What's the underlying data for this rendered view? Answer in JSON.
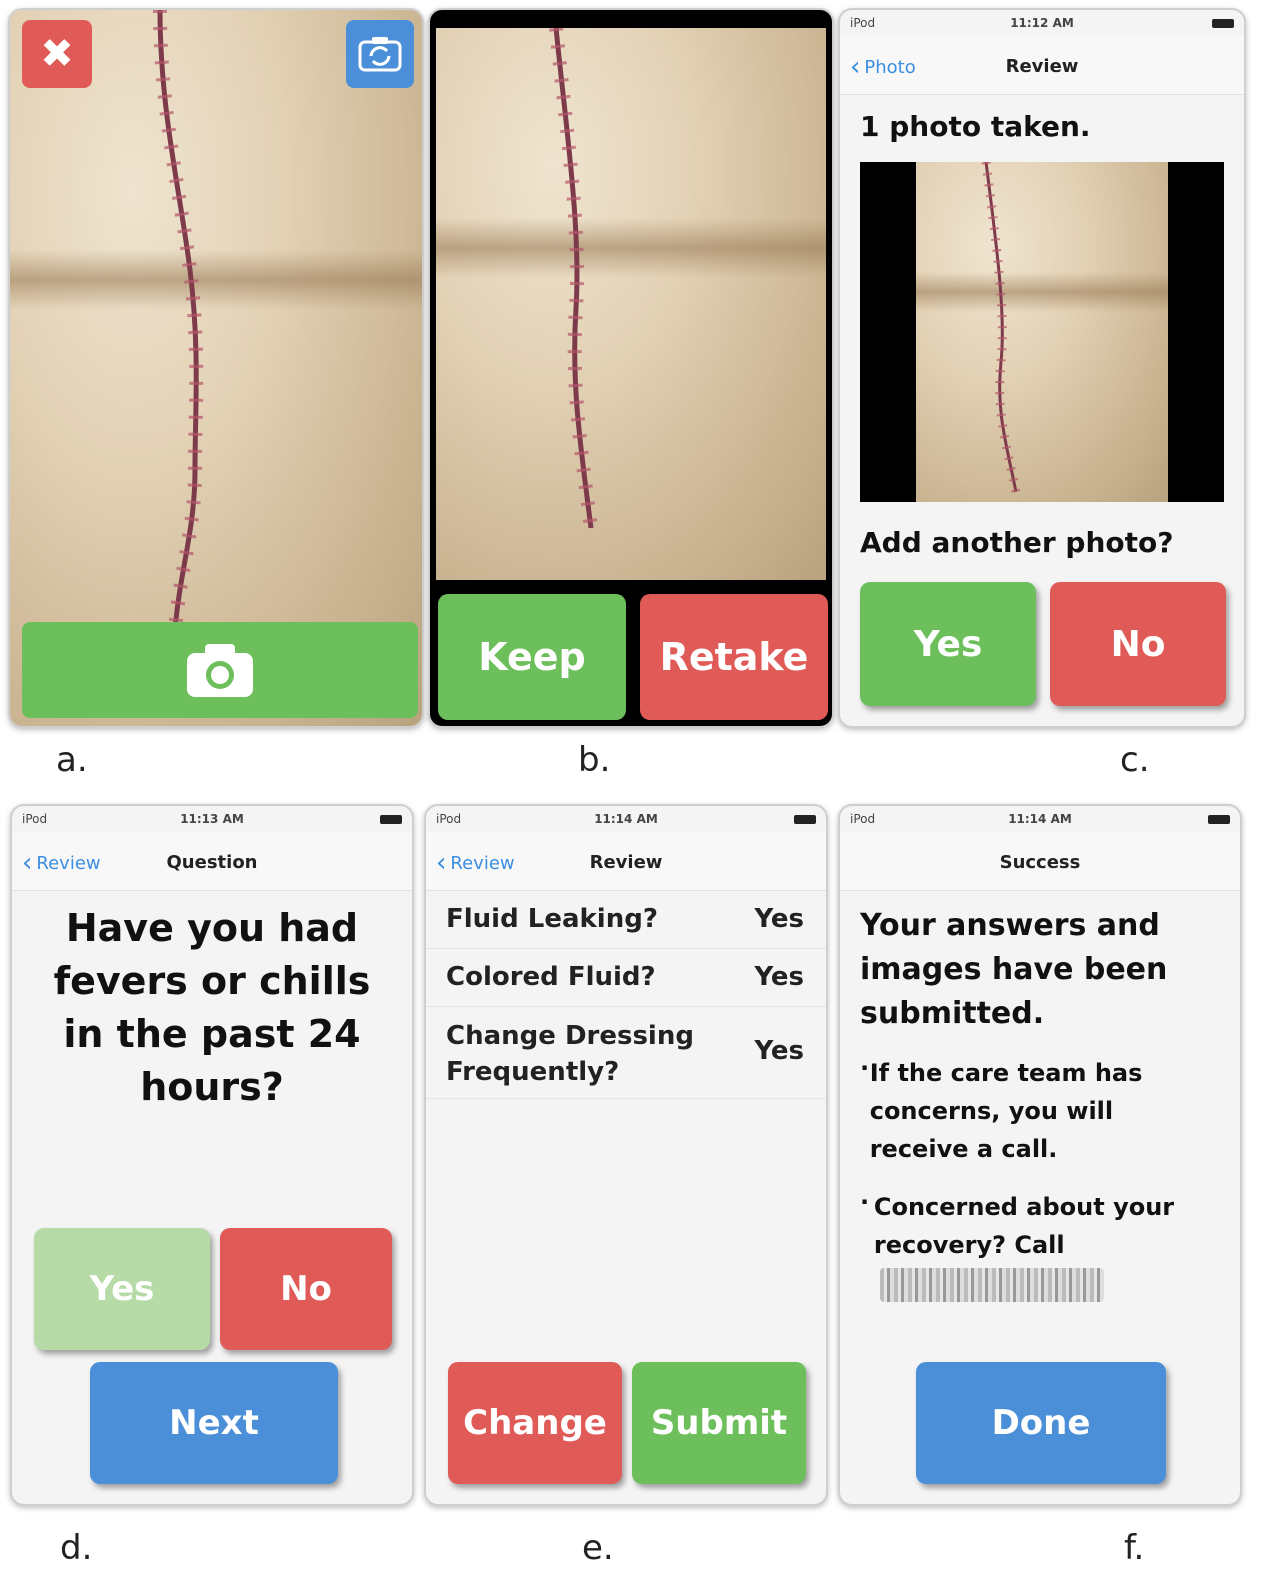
{
  "panels": {
    "a": {
      "caption": "a.",
      "close_icon": "close-icon",
      "switch_camera_icon": "camera-switch-icon",
      "shutter_icon": "camera-icon"
    },
    "b": {
      "caption": "b.",
      "keep_label": "Keep",
      "retake_label": "Retake"
    },
    "c": {
      "caption": "c.",
      "status": {
        "carrier": "iPod",
        "time": "11:12 AM"
      },
      "nav": {
        "back": "Photo",
        "title": "Review"
      },
      "photos_taken": "1 photo taken.",
      "question": "Add another photo?",
      "yes_label": "Yes",
      "no_label": "No"
    },
    "d": {
      "caption": "d.",
      "status": {
        "carrier": "iPod",
        "time": "11:13 AM"
      },
      "nav": {
        "back": "Review",
        "title": "Question"
      },
      "question": "Have you had fevers or chills in the past 24 hours?",
      "yes_label": "Yes",
      "no_label": "No",
      "next_label": "Next"
    },
    "e": {
      "caption": "e.",
      "status": {
        "carrier": "iPod",
        "time": "11:14 AM"
      },
      "nav": {
        "back": "Review",
        "title": "Review"
      },
      "rows": [
        {
          "q": "Fluid Leaking?",
          "a": "Yes"
        },
        {
          "q": "Colored Fluid?",
          "a": "Yes"
        },
        {
          "q": "Change Dressing Frequently?",
          "a": "Yes"
        }
      ],
      "change_label": "Change",
      "submit_label": "Submit"
    },
    "f": {
      "caption": "f.",
      "status": {
        "carrier": "iPod",
        "time": "11:14 AM"
      },
      "nav": {
        "title": "Success"
      },
      "message": "Your answers and images have been submitted.",
      "bullet1": "If the care team has concerns, you will receive a call.",
      "bullet2": "Concerned about your recovery? Call",
      "done_label": "Done"
    }
  },
  "colors": {
    "green": "#6cbf5a",
    "red": "#e05b58",
    "blue": "#4a8fd8",
    "ios_link": "#3b8ee0"
  }
}
